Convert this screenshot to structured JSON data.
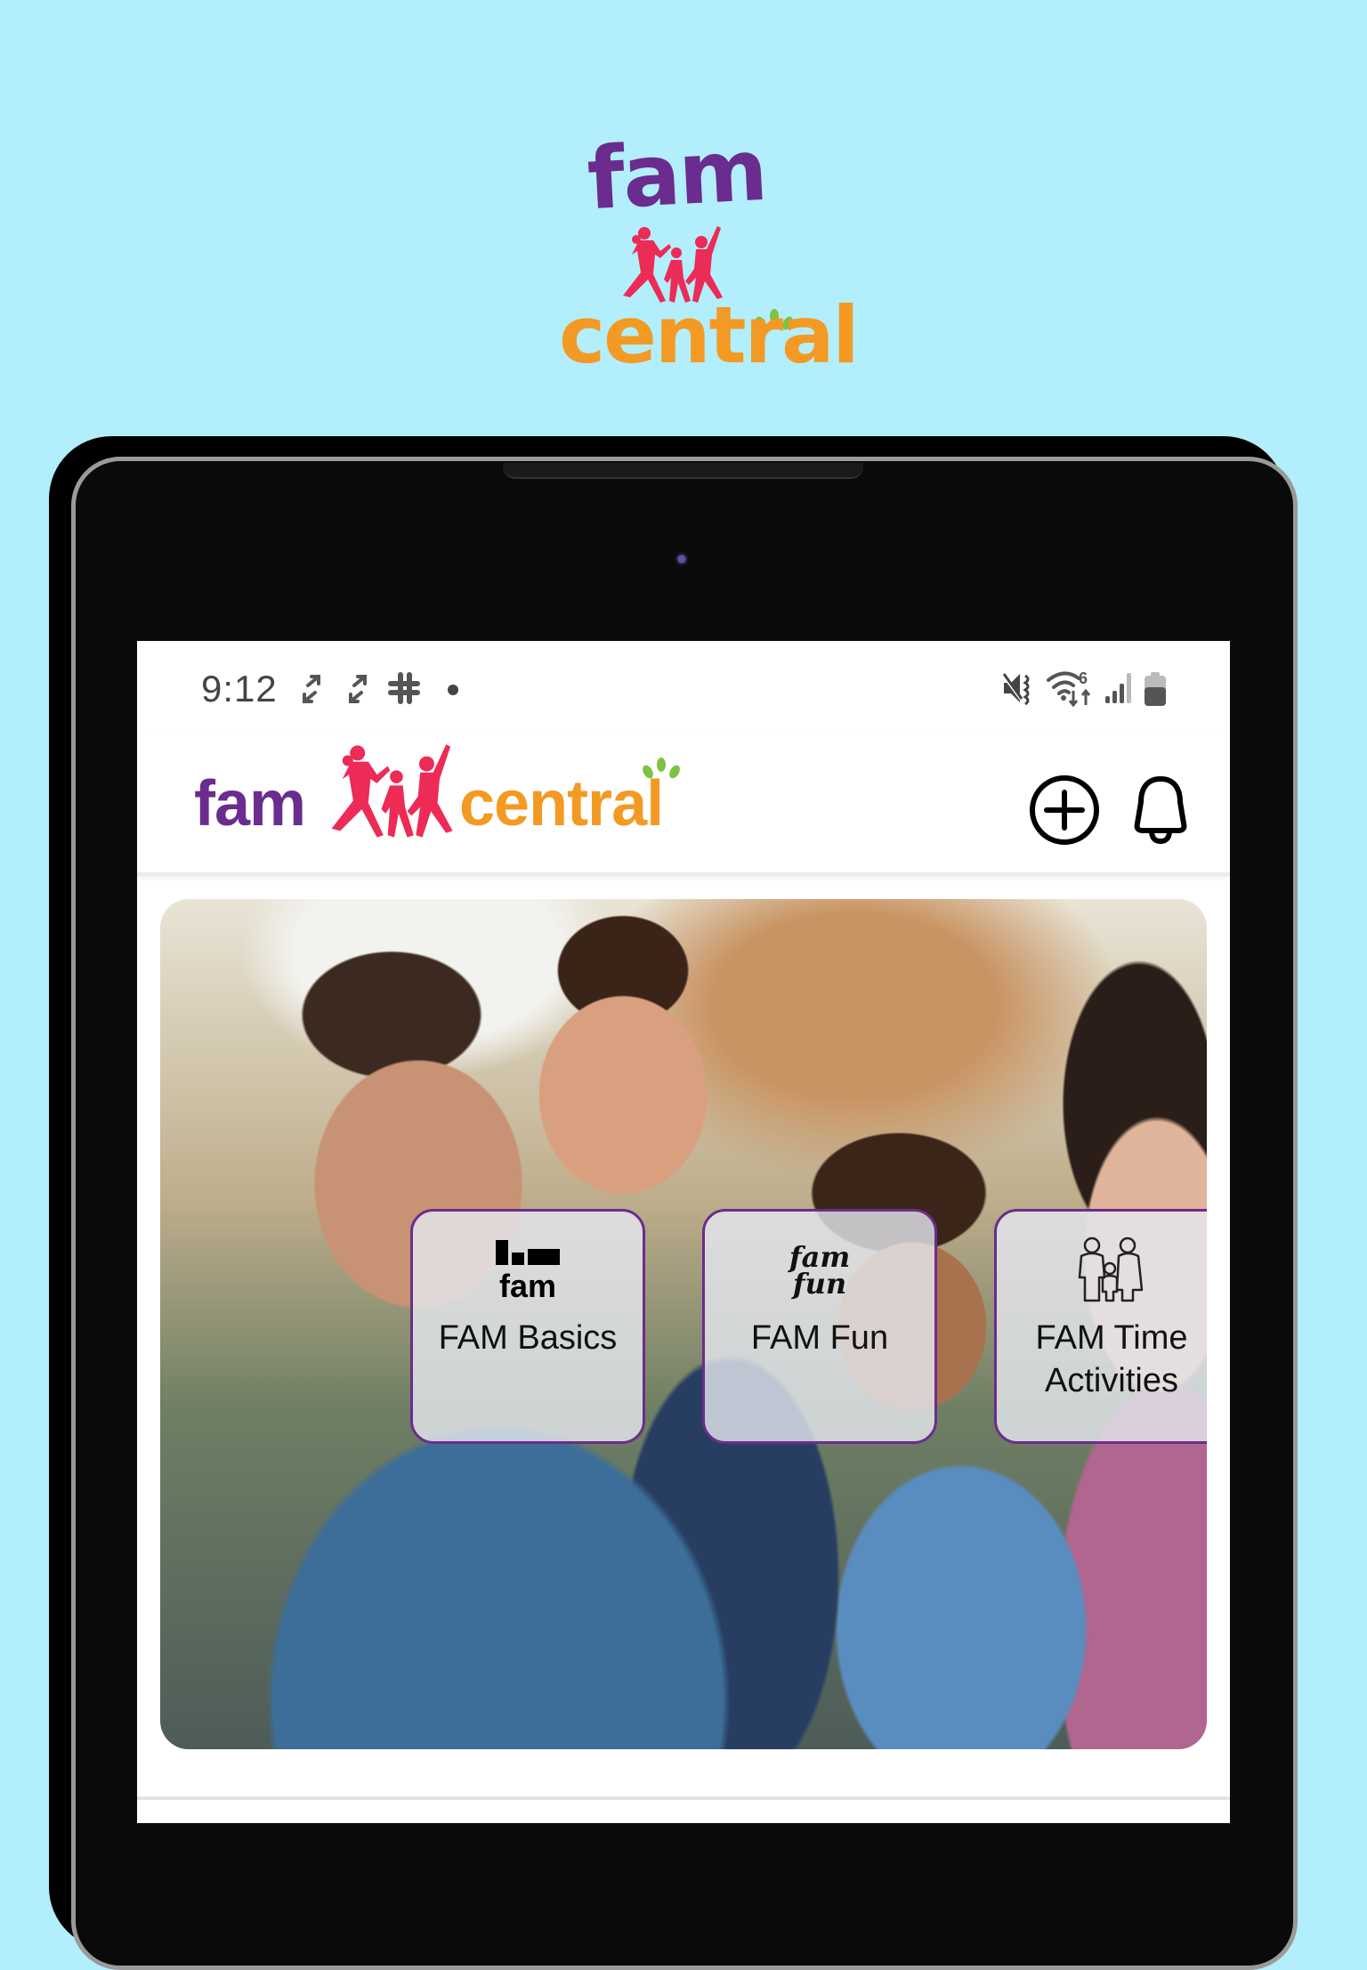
{
  "promo": {
    "logo_word_top": "fam",
    "logo_word_bottom": "central",
    "colors": {
      "background": "#B3EEFC",
      "purple": "#6A2C8E",
      "pink": "#EC2B57",
      "orange": "#F39A24",
      "green": "#7DC242"
    }
  },
  "status_bar": {
    "time": "9:12",
    "left_icons": [
      "sync-icon",
      "sync-icon",
      "slack-icon",
      "notification-dot-icon"
    ],
    "right_icons": [
      "vibrate-mute-icon",
      "wifi-6-icon",
      "cellular-signal-icon",
      "battery-icon"
    ],
    "wifi_label": "6"
  },
  "header": {
    "logo_fam": "fam",
    "logo_central": "central",
    "add_button_icon": "plus-circle-icon",
    "notifications_icon": "bell-icon"
  },
  "hero": {
    "image_alt": "Smiling family: father giving son a piggyback, daughter and mother",
    "tiles": [
      {
        "label": "FAM Basics",
        "icon": "fam-basics-icon",
        "icon_text": "fam"
      },
      {
        "label": "FAM Fun",
        "icon": "fam-fun-icon",
        "icon_text_1": "fam",
        "icon_text_2": "fun"
      },
      {
        "label_line1": "FAM Time",
        "label_line2": "Activities",
        "icon": "family-icon"
      }
    ],
    "tile_border_color": "#6B2D8A"
  }
}
